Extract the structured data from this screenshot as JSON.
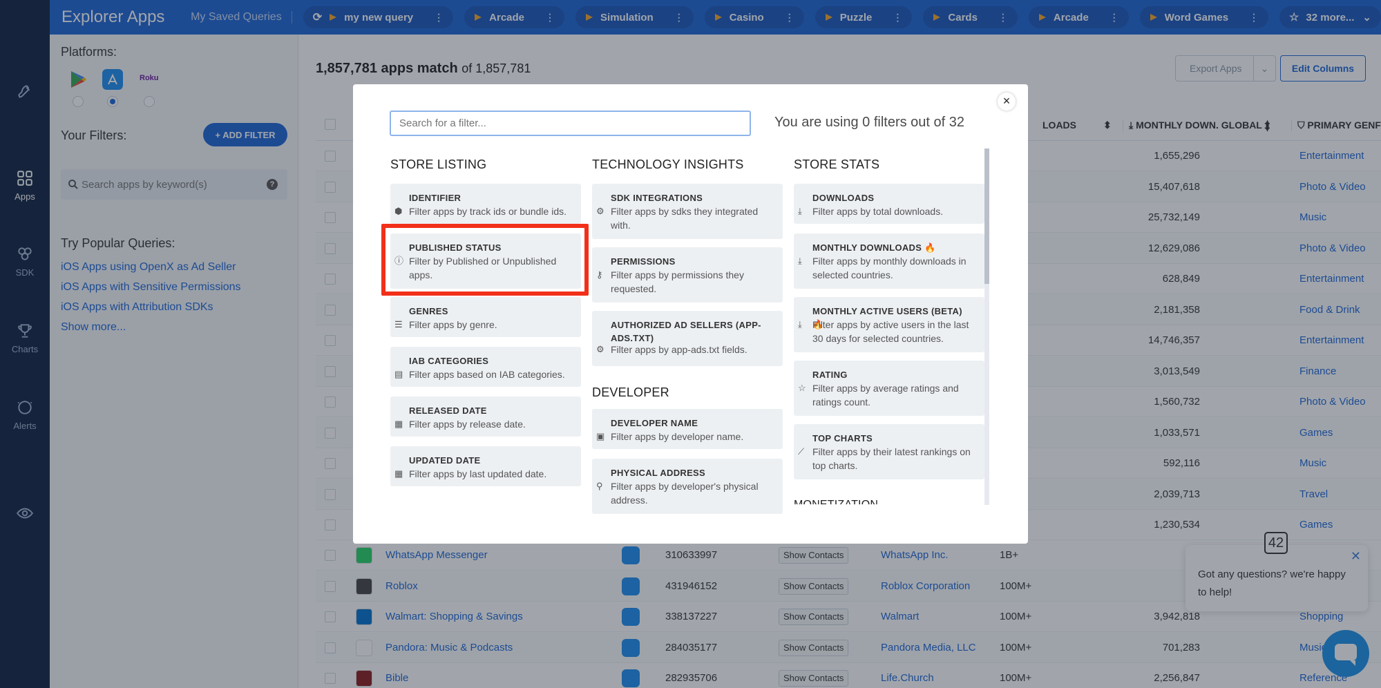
{
  "app": {
    "title": "Explorer Apps",
    "saved_queries_label": "My Saved Queries"
  },
  "query_tabs": [
    {
      "label": "my new query",
      "has_refresh": true
    },
    {
      "label": "Arcade"
    },
    {
      "label": "Simulation"
    },
    {
      "label": "Casino"
    },
    {
      "label": "Puzzle"
    },
    {
      "label": "Cards"
    },
    {
      "label": "Arcade"
    },
    {
      "label": "Word Games"
    }
  ],
  "more_tab": "32 more...",
  "rail": [
    {
      "label": "",
      "icon": "rocket-icon"
    },
    {
      "label": "Apps",
      "icon": "apps-grid-icon",
      "active": true
    },
    {
      "label": "SDK",
      "icon": "sdk-icon"
    },
    {
      "label": "Charts",
      "icon": "trophy-icon"
    },
    {
      "label": "Alerts",
      "icon": "alert-icon"
    },
    {
      "label": "",
      "icon": "eye-icon"
    }
  ],
  "panel": {
    "platforms_label": "Platforms:",
    "roku_label": "Roku",
    "your_filters_label": "Your Filters:",
    "add_filter_label": "+ ADD FILTER",
    "keyword_placeholder": "Search apps by keyword(s)",
    "help_glyph": "?",
    "popular_label": "Try Popular Queries:",
    "popular": [
      "iOS Apps using OpenX as Ad Seller",
      "iOS Apps with Sensitive Permissions",
      "iOS Apps with Attribution SDKs",
      "Show more..."
    ]
  },
  "table": {
    "match_count": "1,857,781 apps match",
    "match_total": "of 1,857,781",
    "export_label": "Export Apps",
    "edit_columns_label": "Edit Columns",
    "headers": {
      "downloads": "LOADS",
      "monthly": "MONTHLY DOWN. GLOBAL",
      "genre": "PRIMARY GENF"
    },
    "top_rows": [
      {
        "monthly": "1,655,296",
        "genre": "Entertainment"
      },
      {
        "monthly": "15,407,618",
        "genre": "Photo & Video"
      },
      {
        "monthly": "25,732,149",
        "genre": "Music"
      },
      {
        "monthly": "12,629,086",
        "genre": "Photo & Video"
      },
      {
        "monthly": "628,849",
        "genre": "Entertainment"
      },
      {
        "monthly": "2,181,358",
        "genre": "Food & Drink"
      },
      {
        "monthly": "14,746,357",
        "genre": "Entertainment"
      },
      {
        "monthly": "3,013,549",
        "genre": "Finance"
      },
      {
        "monthly": "1,560,732",
        "genre": "Photo & Video"
      },
      {
        "monthly": "1,033,571",
        "genre": "Games"
      },
      {
        "monthly": "592,116",
        "genre": "Music"
      },
      {
        "monthly": "2,039,713",
        "genre": "Travel"
      },
      {
        "monthly": "1,230,534",
        "genre": "Games"
      }
    ],
    "bottom_rows": [
      {
        "name": "WhatsApp Messenger",
        "id": "310633997",
        "contacts": "Show Contacts",
        "dev": "WhatsApp Inc.",
        "dl": "1B+",
        "monthly": "",
        "genre": "",
        "icon_color": "#25d366"
      },
      {
        "name": "Roblox",
        "id": "431946152",
        "contacts": "Show Contacts",
        "dev": "Roblox Corporation",
        "dl": "100M+",
        "monthly": "",
        "genre": "",
        "icon_color": "#444444"
      },
      {
        "name": "Walmart: Shopping & Savings",
        "id": "338137227",
        "contacts": "Show Contacts",
        "dev": "Walmart",
        "dl": "100M+",
        "monthly": "3,942,818",
        "genre": "Shopping",
        "icon_color": "#0071ce"
      },
      {
        "name": "Pandora: Music & Podcasts",
        "id": "284035177",
        "contacts": "Show Contacts",
        "dev": "Pandora Media, LLC",
        "dl": "100M+",
        "monthly": "701,283",
        "genre": "Music",
        "icon_color": "#ffffff"
      },
      {
        "name": "Bible",
        "id": "282935706",
        "contacts": "Show Contacts",
        "dev": "Life.Church",
        "dl": "100M+",
        "monthly": "2,256,847",
        "genre": "Reference",
        "icon_color": "#8b1a1a"
      }
    ]
  },
  "modal": {
    "search_placeholder": "Search for a filter...",
    "usage_text": "You are using 0 filters out of 32",
    "close_glyph": "×",
    "columns": {
      "store_listing": {
        "title": "STORE LISTING",
        "cards": [
          {
            "title": "IDENTIFIER",
            "desc": "Filter apps by track ids or bundle ids.",
            "icon": "cube-icon"
          },
          {
            "title": "PUBLISHED STATUS",
            "desc": "Filter by Published or Unpublished apps.",
            "icon": "info-icon"
          },
          {
            "title": "GENRES",
            "desc": "Filter apps by genre.",
            "icon": "list-icon"
          },
          {
            "title": "IAB CATEGORIES",
            "desc": "Filter apps based on IAB categories.",
            "icon": "id-card-icon"
          },
          {
            "title": "RELEASED DATE",
            "desc": "Filter apps by release date.",
            "icon": "calendar-icon"
          },
          {
            "title": "UPDATED DATE",
            "desc": "Filter apps by last updated date.",
            "icon": "calendar-icon"
          }
        ]
      },
      "technology": {
        "title": "TECHNOLOGY INSIGHTS",
        "cards": [
          {
            "title": "SDK INTEGRATIONS",
            "desc": "Filter apps by sdks they integrated with.",
            "icon": "gear-icon"
          },
          {
            "title": "PERMISSIONS",
            "desc": "Filter apps by permissions they requested.",
            "icon": "key-icon"
          },
          {
            "title": "AUTHORIZED AD SELLERS (APP-ADS.TXT)",
            "desc": "Filter apps by app-ads.txt fields.",
            "icon": "gear-icon"
          }
        ]
      },
      "developer": {
        "title": "DEVELOPER",
        "cards": [
          {
            "title": "DEVELOPER NAME",
            "desc": "Filter apps by developer name.",
            "icon": "badge-icon"
          },
          {
            "title": "PHYSICAL ADDRESS",
            "desc": "Filter apps by developer's physical address.",
            "icon": "map-pin-icon"
          }
        ]
      },
      "store_stats": {
        "title": "STORE STATS",
        "cards": [
          {
            "title": "DOWNLOADS",
            "desc": "Filter apps by total downloads.",
            "icon": "download-icon"
          },
          {
            "title": "MONTHLY DOWNLOADS",
            "desc": "Filter apps by monthly downloads in selected countries.",
            "icon": "download-icon",
            "hot": true
          },
          {
            "title": "MONTHLY ACTIVE USERS (BETA)",
            "desc": "Filter apps by active users in the last 30 days for selected countries.",
            "icon": "download-icon",
            "hot": true
          },
          {
            "title": "RATING",
            "desc": "Filter apps by average ratings and ratings count.",
            "icon": "star-icon"
          },
          {
            "title": "TOP CHARTS",
            "desc": "Filter apps by their latest rankings on top charts.",
            "icon": "chart-line-icon"
          }
        ]
      }
    },
    "next_section_partial": "MONETIZATION"
  },
  "chat": {
    "message": "Got any questions? we're happy to help!",
    "badge": "42",
    "close_glyph": "✕"
  },
  "colors": {
    "brand": "#1c64d4",
    "rail": "#0f2240",
    "highlight": "#f2301a"
  }
}
